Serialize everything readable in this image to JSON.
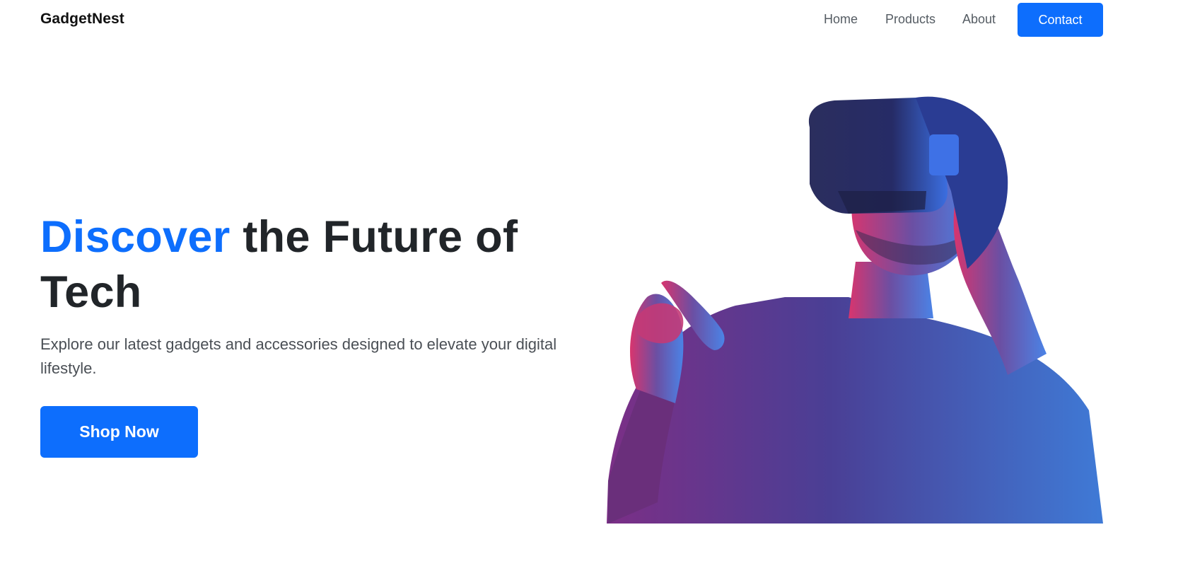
{
  "navbar": {
    "brand": "GadgetNest",
    "links": [
      "Home",
      "Products",
      "About"
    ],
    "contact_label": "Contact"
  },
  "hero": {
    "title_accent": "Discover",
    "title_rest": " the Future of Tech",
    "subtitle": "Explore our latest gadgets and accessories designed to elevate your digital lifestyle.",
    "cta_label": "Shop Now",
    "image_subject": "person-wearing-vr-headset"
  },
  "colors": {
    "primary": "#0d6efd",
    "text_dark": "#212529",
    "text_muted": "#555c63",
    "background": "#ffffff"
  }
}
